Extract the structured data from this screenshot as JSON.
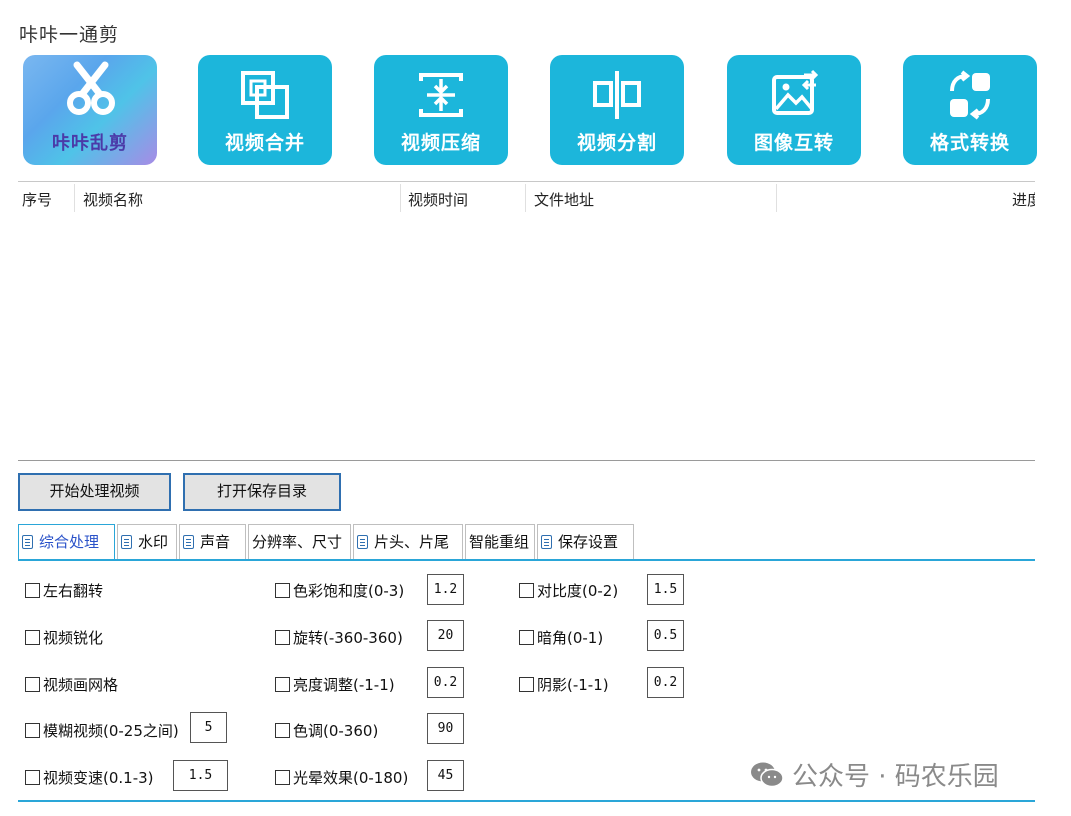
{
  "app_title": "咔咔一通剪",
  "toolbar": [
    {
      "label": "咔咔乱剪",
      "icon": "scissors-icon"
    },
    {
      "label": "视频合并",
      "icon": "merge-icon"
    },
    {
      "label": "视频压缩",
      "icon": "compress-icon"
    },
    {
      "label": "视频分割",
      "icon": "split-icon"
    },
    {
      "label": "图像互转",
      "icon": "image-convert-icon"
    },
    {
      "label": "格式转换",
      "icon": "format-convert-icon"
    }
  ],
  "table": {
    "columns": [
      "序号",
      "视频名称",
      "视频时间",
      "文件地址",
      "进度"
    ],
    "rows": []
  },
  "actions": {
    "start": "开始处理视频",
    "open_dir": "打开保存目录"
  },
  "tabs": [
    {
      "label": "综合处理",
      "icon": "doc-icon",
      "active": true
    },
    {
      "label": "水印",
      "icon": "doc-icon"
    },
    {
      "label": "声音",
      "icon": "doc-icon"
    },
    {
      "label": "分辨率、尺寸"
    },
    {
      "label": "片头、片尾",
      "icon": "doc-icon"
    },
    {
      "label": "智能重组"
    },
    {
      "label": "保存设置",
      "icon": "doc-icon"
    }
  ],
  "options": {
    "col1": [
      {
        "label": "左右翻转"
      },
      {
        "label": "视频锐化"
      },
      {
        "label": "视频画网格"
      },
      {
        "label": "模糊视频(0-25之间)",
        "value": "5"
      },
      {
        "label": "视频变速(0.1-3)",
        "value": "1.5"
      }
    ],
    "col2": [
      {
        "label": "色彩饱和度(0-3)",
        "value": "1.2"
      },
      {
        "label": "旋转(-360-360)",
        "value": "20"
      },
      {
        "label": "亮度调整(-1-1)",
        "value": "0.2"
      },
      {
        "label": "色调(0-360)",
        "value": "90"
      },
      {
        "label": "光晕效果(0-180)",
        "value": "45"
      }
    ],
    "col3": [
      {
        "label": "对比度(0-2)",
        "value": "1.5"
      },
      {
        "label": "暗角(0-1)",
        "value": "0.5"
      },
      {
        "label": "阴影(-1-1)",
        "value": "0.2"
      }
    ]
  },
  "watermark": {
    "text": "公众号 · 码农乐园",
    "icon": "wechat-icon"
  },
  "colors": {
    "accent": "#1cb6db",
    "tab_line": "#2aa6d8",
    "button_border": "#2f6fb0"
  }
}
